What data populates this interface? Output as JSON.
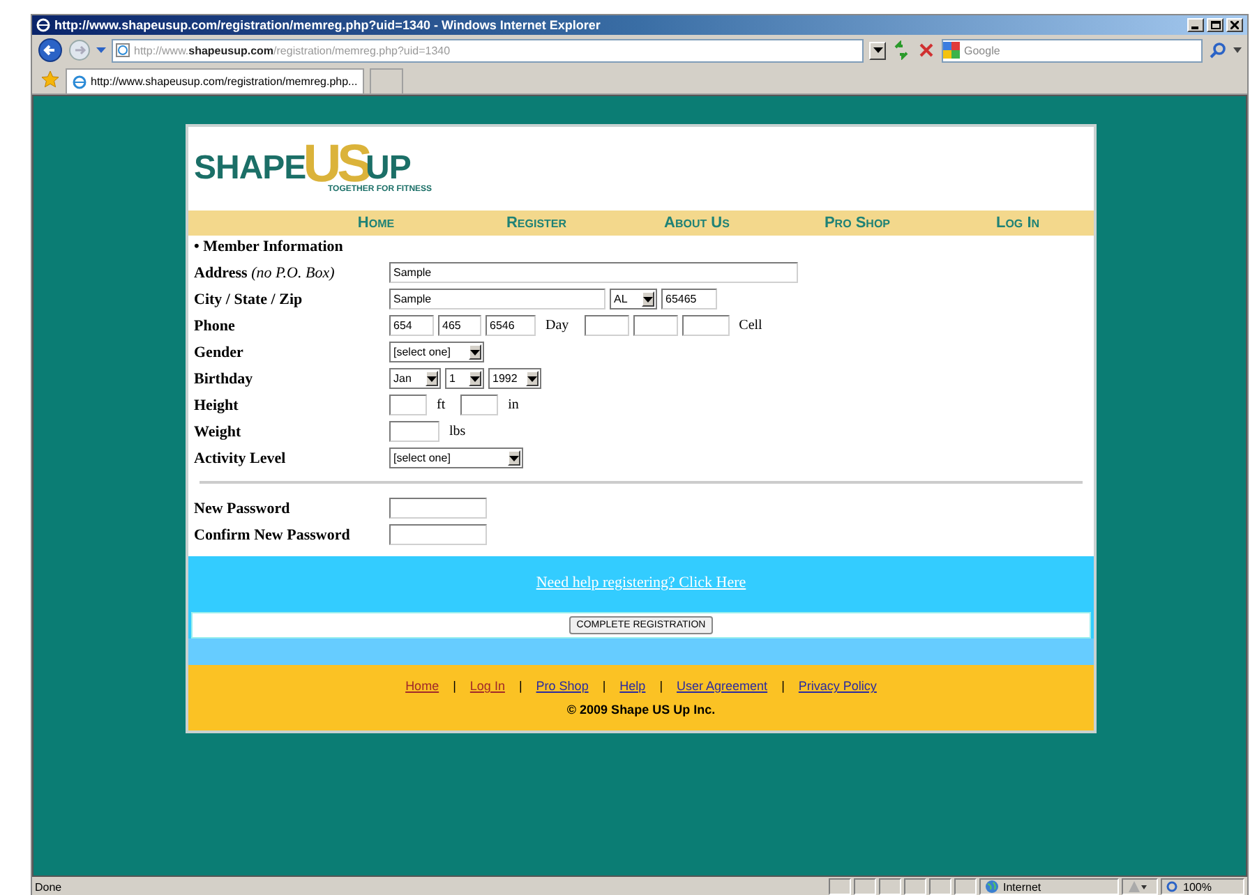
{
  "window": {
    "title": "http://www.shapeusup.com/registration/memreg.php?uid=1340 - Windows Internet Explorer"
  },
  "address_bar": {
    "url": "http://www.**shapeusup.com**/registration/memreg.php?uid=1340"
  },
  "search": {
    "placeholder": "Google"
  },
  "tabs": [
    {
      "label": "http://www.shapeusup.com/registration/memreg.php...",
      "selected": true
    }
  ],
  "logo": {
    "words": [
      "SHAPE",
      "US",
      "UP"
    ],
    "tagline": "TOGETHER FOR FITNESS"
  },
  "nav": [
    "Home",
    "Register",
    "About Us",
    "Pro Shop",
    "Log In"
  ],
  "form": {
    "section": "• Member Information",
    "rows": [
      {
        "kind": "address",
        "label": "Address",
        "note": "(no P.O. Box)",
        "controls": [
          {
            "kind": "text",
            "value": "Sample"
          }
        ]
      },
      {
        "kind": "city",
        "label": "City / State / Zip",
        "controls": [
          {
            "kind": "text",
            "value": "Sample"
          },
          {
            "kind": "select",
            "value": "AL"
          },
          {
            "kind": "text",
            "value": "65465"
          }
        ]
      },
      {
        "kind": "phone",
        "label": "Phone",
        "controls": [
          {
            "kind": "text",
            "value": "654"
          },
          {
            "kind": "text",
            "value": "465"
          },
          {
            "kind": "text",
            "value": "6546"
          },
          {
            "kind": "unit",
            "value": "Day"
          },
          {
            "kind": "text"
          },
          {
            "kind": "text"
          },
          {
            "kind": "text"
          },
          {
            "kind": "unit",
            "value": "Cell"
          }
        ]
      },
      {
        "kind": "gender",
        "label": "Gender",
        "controls": [
          {
            "kind": "select",
            "value": "[select one]"
          }
        ]
      },
      {
        "kind": "birthday",
        "label": "Birthday",
        "controls": [
          {
            "kind": "select",
            "value": "Jan"
          },
          {
            "kind": "select",
            "value": "1"
          },
          {
            "kind": "select",
            "value": "1992"
          }
        ]
      },
      {
        "kind": "height",
        "label": "Height",
        "controls": [
          {
            "kind": "text"
          },
          {
            "kind": "unit",
            "value": "ft"
          },
          {
            "kind": "text"
          },
          {
            "kind": "unit",
            "value": "in"
          }
        ]
      },
      {
        "kind": "weight",
        "label": "Weight",
        "controls": [
          {
            "kind": "text"
          },
          {
            "kind": "unit",
            "value": "lbs"
          }
        ]
      },
      {
        "kind": "activity",
        "label": "Activity Level",
        "controls": [
          {
            "kind": "select",
            "value": "[select one]"
          }
        ]
      }
    ],
    "password_rows": [
      {
        "kind": "password",
        "label": "New Password",
        "controls": [
          {
            "kind": "text"
          }
        ]
      },
      {
        "kind": "password",
        "label": "Confirm New Password",
        "controls": [
          {
            "kind": "text"
          }
        ]
      }
    ]
  },
  "help_link": "Need help registering? Click Here",
  "submit_button": "COMPLETE REGISTRATION",
  "footer": {
    "items": [
      {
        "kind": "link",
        "text": "Home",
        "visited": true
      },
      {
        "kind": "separator",
        "text": "|"
      },
      {
        "kind": "link",
        "text": "Log In",
        "visited": true
      },
      {
        "kind": "separator",
        "text": "|"
      },
      {
        "kind": "link",
        "text": "Pro Shop",
        "visited": false
      },
      {
        "kind": "separator",
        "text": "|"
      },
      {
        "kind": "link",
        "text": "Help",
        "visited": false
      },
      {
        "kind": "separator",
        "text": "|"
      },
      {
        "kind": "link",
        "text": "User Agreement",
        "visited": false
      },
      {
        "kind": "separator",
        "text": "|"
      },
      {
        "kind": "link",
        "text": "Privacy Policy",
        "visited": false
      }
    ],
    "copyright": "© 2009 Shape US Up Inc."
  },
  "status_bar": {
    "status": "Done",
    "zone": "Internet",
    "zoom": "100%"
  }
}
